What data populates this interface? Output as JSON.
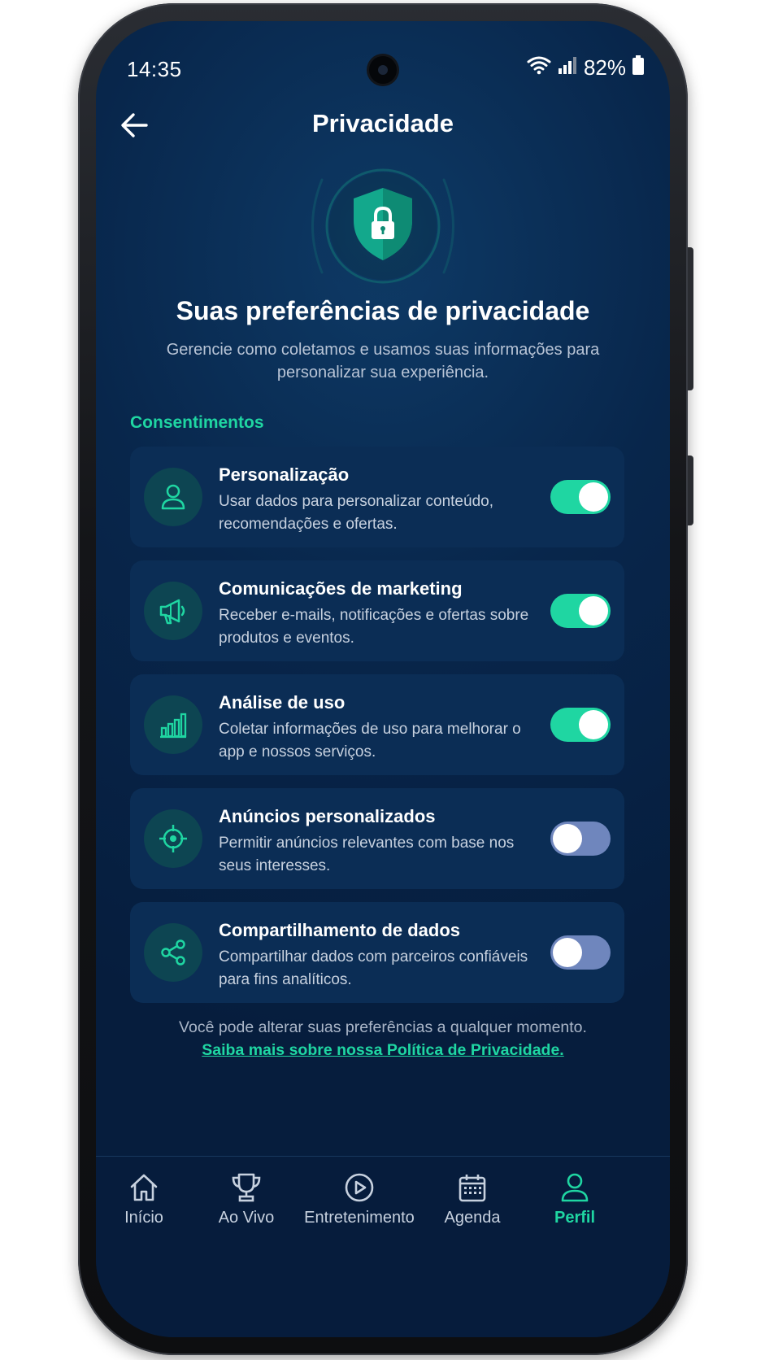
{
  "status_bar": {
    "time": "14:35",
    "battery": "82%"
  },
  "header": {
    "title": "Privacidade"
  },
  "hero": {
    "title": "Suas preferências de privacidade",
    "subtitle": "Gerencie como coletamos e usamos suas informações para personalizar sua experiência."
  },
  "section": {
    "label": "Consentimentos"
  },
  "consents": [
    {
      "title": "Personalização",
      "description": "Usar dados para personalizar conteúdo, recomendações e ofertas.",
      "icon": "user-icon",
      "enabled": true
    },
    {
      "title": "Comunicações de marketing",
      "description": "Receber e-mails, notificações e ofertas sobre produtos e eventos.",
      "icon": "megaphone-icon",
      "enabled": true
    },
    {
      "title": "Análise de uso",
      "description": "Coletar informações de uso para melhorar o app e nossos serviços.",
      "icon": "bar-chart-icon",
      "enabled": true
    },
    {
      "title": "Anúncios personalizados",
      "description": "Permitir anúncios relevantes com base nos seus interesses.",
      "icon": "target-icon",
      "enabled": false
    },
    {
      "title": "Compartilhamento de dados",
      "description": "Compartilhar dados com parceiros confiáveis para fins analíticos.",
      "icon": "share-icon",
      "enabled": false
    }
  ],
  "footer": {
    "note": "Você pode alterar suas preferências a qualquer momento.",
    "link": "Saiba mais sobre nossa Política de Privacidade."
  },
  "nav": [
    {
      "label": "Início",
      "icon": "home-icon",
      "active": false
    },
    {
      "label": "Ao Vivo",
      "icon": "trophy-icon",
      "active": false
    },
    {
      "label": "Entretenimento",
      "icon": "play-circle-icon",
      "active": false
    },
    {
      "label": "Agenda",
      "icon": "calendar-icon",
      "active": false
    },
    {
      "label": "Perfil",
      "icon": "profile-icon",
      "active": true
    }
  ],
  "colors": {
    "accent": "#1fd6a2",
    "background": "#061d3d",
    "card": "#0b2d55",
    "toggle_off": "#6f86bd"
  }
}
